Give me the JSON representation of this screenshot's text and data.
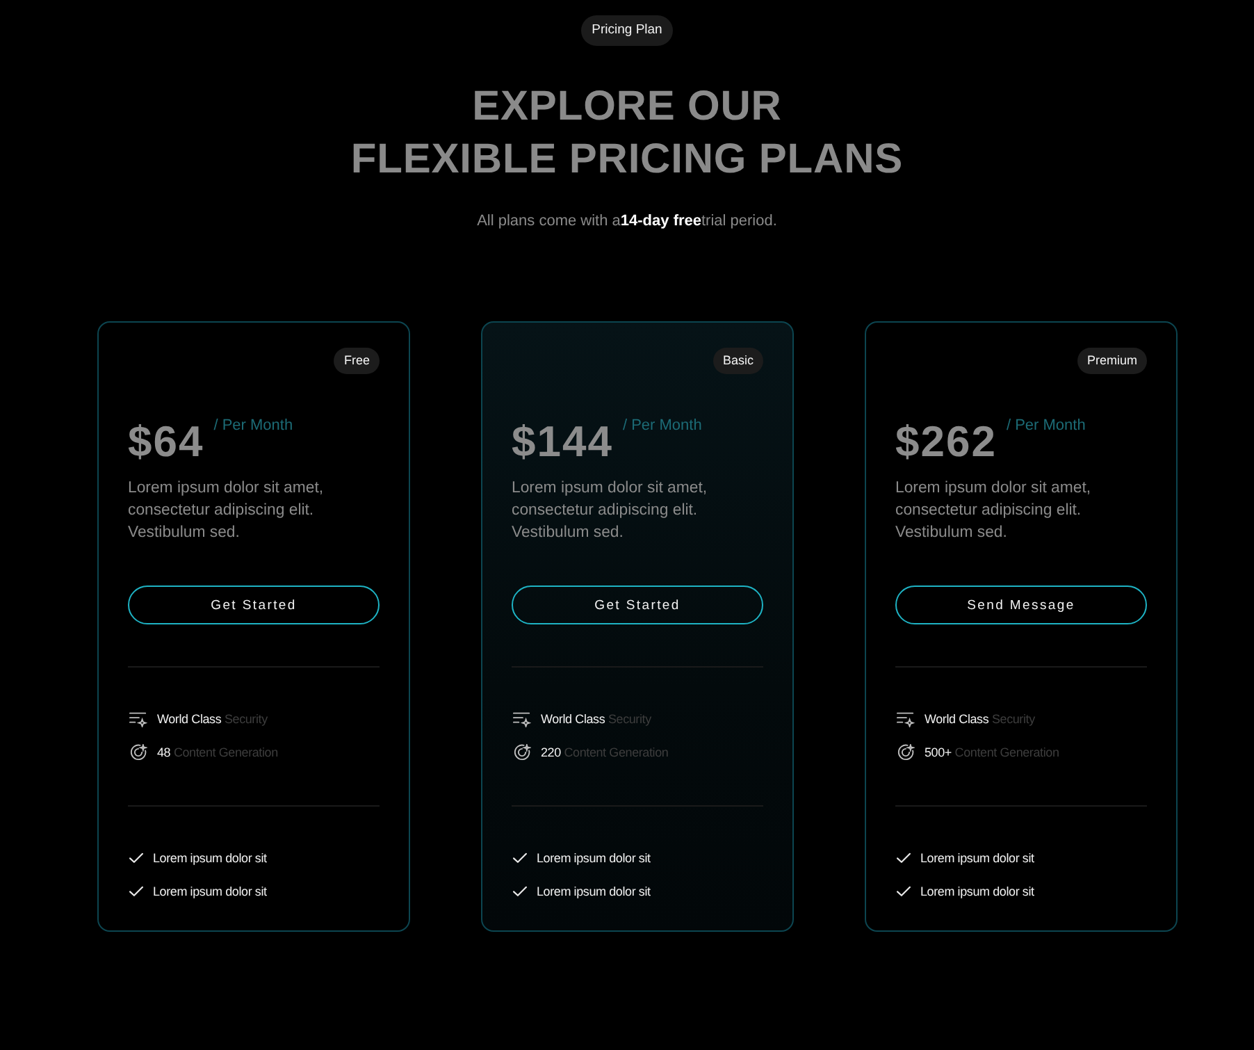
{
  "badge": "Pricing Plan",
  "title": [
    "EXPLORE OUR",
    "FLEXIBLE PRICING PLANS"
  ],
  "subtitle": "All plans come with a**14-day free**trial period.",
  "plans": [
    {
      "tier": "Free",
      "price": "$64",
      "period": "/ Per Month",
      "description": "Lorem ipsum dolor sit amet, consectetur adipiscing elit. Vestibulum sed.",
      "button": "Get Started",
      "highlighted": false,
      "features": [
        {
          "kind": "security",
          "strong": "World Class",
          "text": "Security"
        },
        {
          "kind": "generation",
          "strong": "48",
          "text": "Content Generation"
        }
      ],
      "checklist": [
        "Lorem ipsum dolor sit",
        "Lorem ipsum dolor sit"
      ]
    },
    {
      "tier": "Basic",
      "price": "$144",
      "period": "/ Per Month",
      "description": "Lorem ipsum dolor sit amet, consectetur adipiscing elit. Vestibulum sed.",
      "button": "Get Started",
      "highlighted": true,
      "features": [
        {
          "kind": "security",
          "strong": "World Class",
          "text": "Security"
        },
        {
          "kind": "generation",
          "strong": "220",
          "text": "Content Generation"
        }
      ],
      "checklist": [
        "Lorem ipsum dolor sit",
        "Lorem ipsum dolor sit"
      ]
    },
    {
      "tier": "Premium",
      "price": "$262",
      "period": "/ Per Month",
      "description": "Lorem ipsum dolor sit amet, consectetur adipiscing elit. Vestibulum sed.",
      "button": "Send Message",
      "highlighted": false,
      "features": [
        {
          "kind": "security",
          "strong": "World Class",
          "text": "Security"
        },
        {
          "kind": "generation",
          "strong": "500+",
          "text": "Content Generation"
        }
      ],
      "checklist": [
        "Lorem ipsum dolor sit",
        "Lorem ipsum dolor sit"
      ]
    }
  ]
}
